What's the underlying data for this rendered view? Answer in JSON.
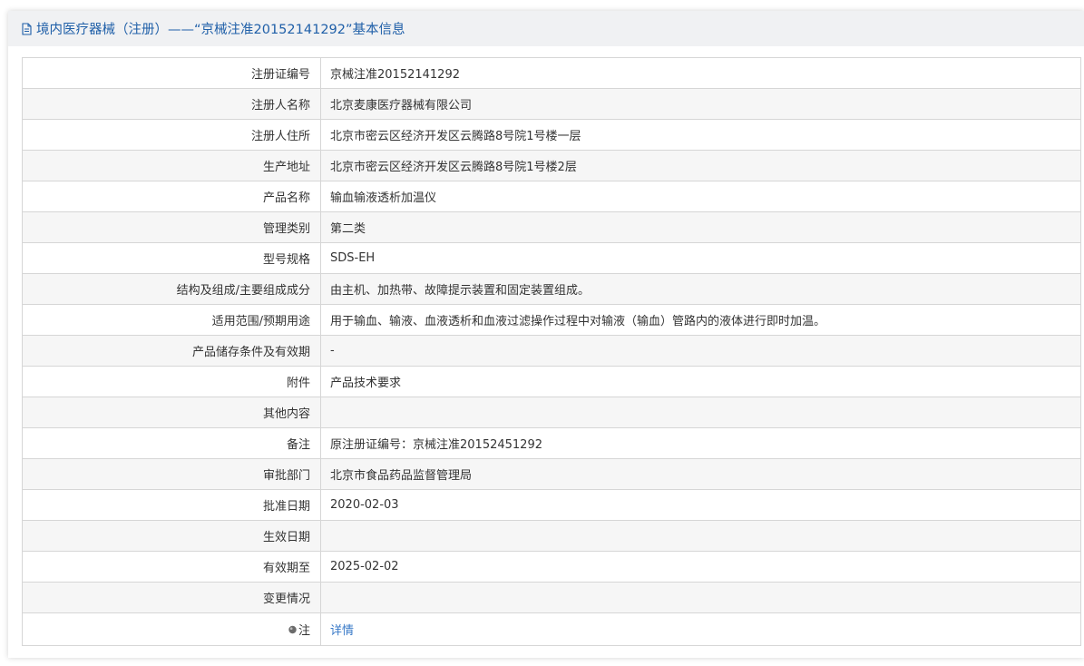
{
  "header": {
    "title": "境内医疗器械（注册）——“京械注准20152141292”基本信息"
  },
  "rows": [
    {
      "label": "注册证编号",
      "value": "京械注准20152141292"
    },
    {
      "label": "注册人名称",
      "value": "北京麦康医疗器械有限公司"
    },
    {
      "label": "注册人住所",
      "value": "北京市密云区经济开发区云腾路8号院1号楼一层"
    },
    {
      "label": "生产地址",
      "value": "北京市密云区经济开发区云腾路8号院1号楼2层"
    },
    {
      "label": "产品名称",
      "value": "输血输液透析加温仪"
    },
    {
      "label": "管理类别",
      "value": "第二类"
    },
    {
      "label": "型号规格",
      "value": "SDS-EH"
    },
    {
      "label": "结构及组成/主要组成成分",
      "value": "由主机、加热带、故障提示装置和固定装置组成。"
    },
    {
      "label": "适用范围/预期用途",
      "value": "用于输血、输液、血液透析和血液过滤操作过程中对输液（输血）管路内的液体进行即时加温。"
    },
    {
      "label": "产品储存条件及有效期",
      "value": "-"
    },
    {
      "label": "附件",
      "value": "产品技术要求"
    },
    {
      "label": "其他内容",
      "value": ""
    },
    {
      "label": "备注",
      "value": "原注册证编号：京械注准20152451292"
    },
    {
      "label": "审批部门",
      "value": "北京市食品药品监督管理局"
    },
    {
      "label": "批准日期",
      "value": "2020-02-03"
    },
    {
      "label": "生效日期",
      "value": ""
    },
    {
      "label": "有效期至",
      "value": "2025-02-02"
    },
    {
      "label": "变更情况",
      "value": ""
    }
  ],
  "note": {
    "label": "注",
    "icon": "pin-icon",
    "link_text": "详情"
  },
  "colors": {
    "header_text": "#1f5fa8",
    "link": "#3778c7",
    "border": "#d6d6d6"
  }
}
